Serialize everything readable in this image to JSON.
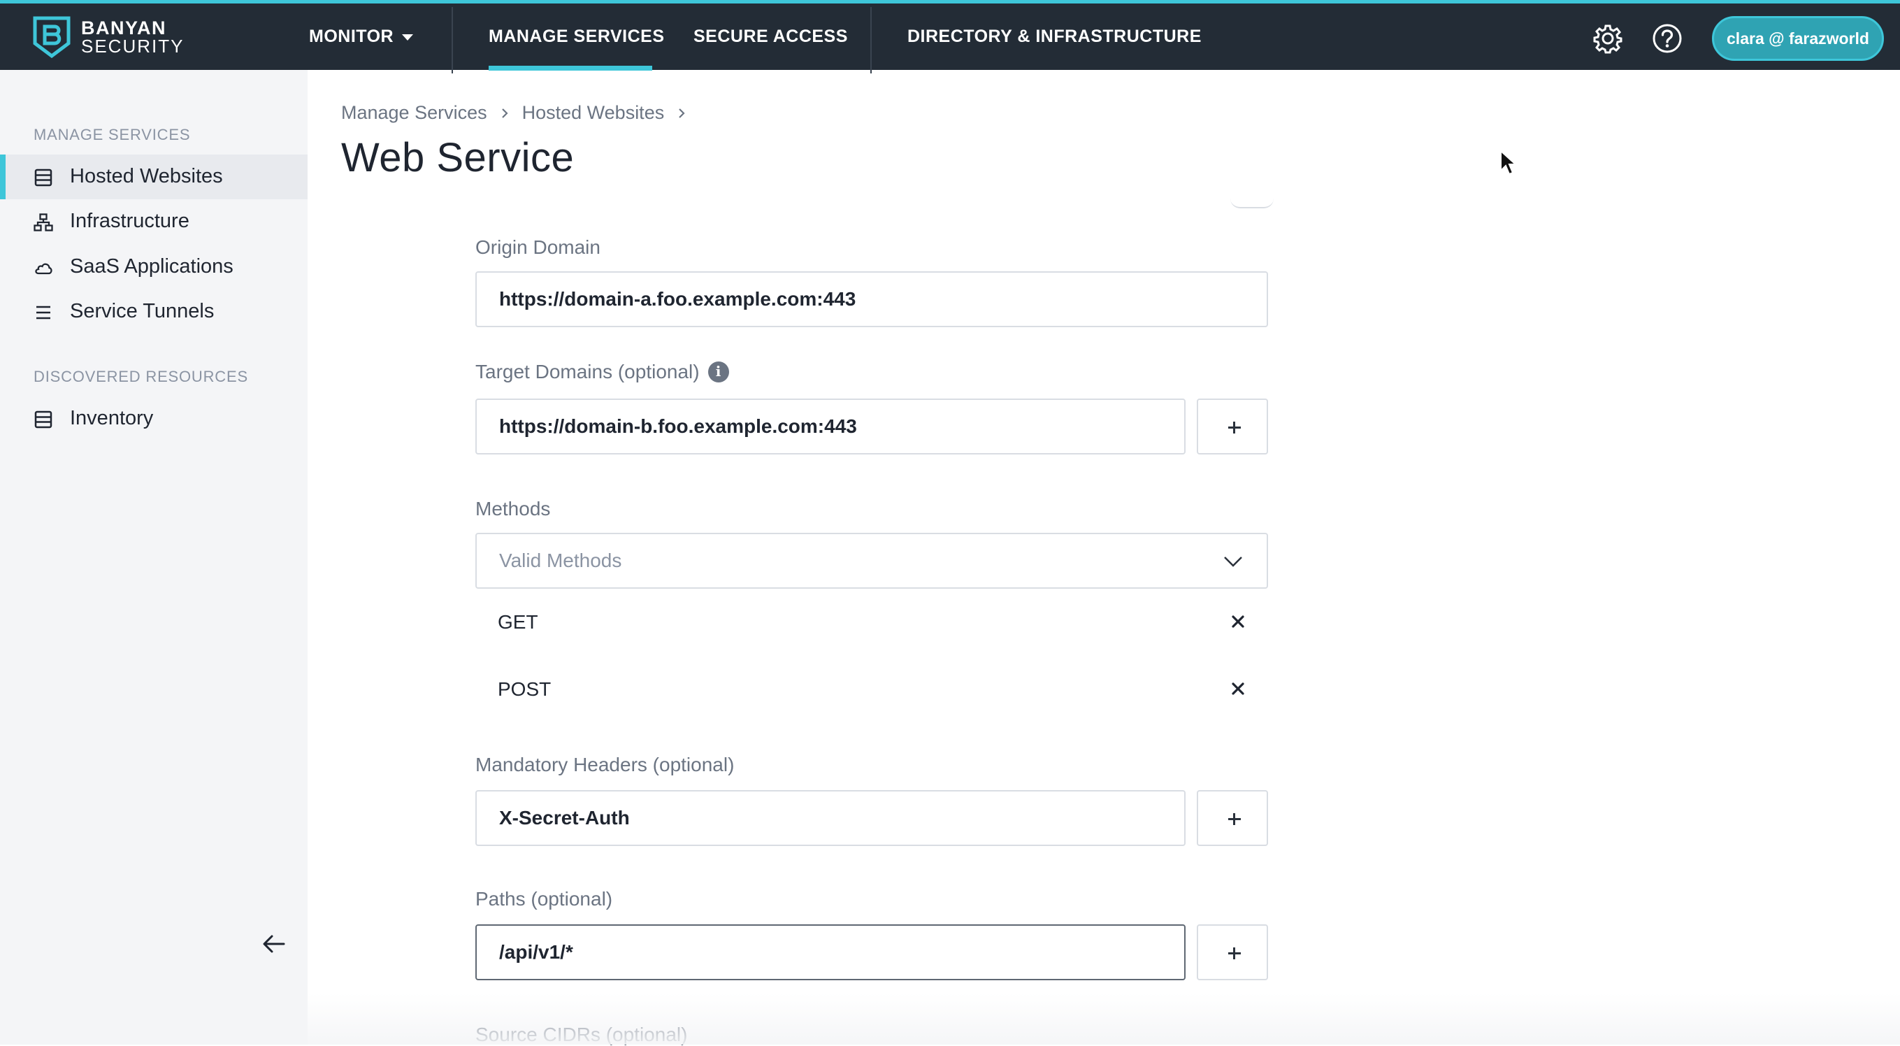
{
  "brand": {
    "line1": "BANYAN",
    "line2": "SECURITY"
  },
  "topnav": {
    "monitor": "MONITOR",
    "manage_services": "MANAGE SERVICES",
    "secure_access": "SECURE ACCESS",
    "directory_infrastructure": "DIRECTORY & INFRASTRUCTURE",
    "active": "MANAGE SERVICES",
    "accent_color": "#3ec6d9",
    "settings_icon": "gear-icon",
    "help_icon": "question-circle-icon"
  },
  "user": {
    "label": "clara @ farazworld"
  },
  "sidebar": {
    "section1": "MANAGE SERVICES",
    "items": [
      {
        "label": "Hosted Websites",
        "icon": "server-list-icon",
        "active": true
      },
      {
        "label": "Infrastructure",
        "icon": "network-icon",
        "active": false
      },
      {
        "label": "SaaS Applications",
        "icon": "cloud-icon",
        "active": false
      },
      {
        "label": "Service Tunnels",
        "icon": "lines-icon",
        "active": false
      }
    ],
    "section2": "DISCOVERED RESOURCES",
    "items2": [
      {
        "label": "Inventory",
        "icon": "server-list-icon",
        "active": false
      }
    ],
    "collapse_icon": "arrow-left-icon"
  },
  "breadcrumb": {
    "crumb1": "Manage Services",
    "crumb2": "Hosted Websites"
  },
  "page": {
    "title": "Web Service"
  },
  "form": {
    "origin_domain": {
      "label": "Origin Domain",
      "value": "https://domain-a.foo.example.com:443"
    },
    "target_domains": {
      "label": "Target Domains (optional)",
      "value": "https://domain-b.foo.example.com:443"
    },
    "methods": {
      "label": "Methods",
      "placeholder": "Valid Methods",
      "selected": [
        "GET",
        "POST"
      ]
    },
    "mandatory_headers": {
      "label": "Mandatory Headers (optional)",
      "value": "X-Secret-Auth"
    },
    "paths": {
      "label": "Paths (optional)",
      "value": "/api/v1/*"
    },
    "source_cidrs": {
      "label": "Source CIDRs (optional)"
    }
  }
}
